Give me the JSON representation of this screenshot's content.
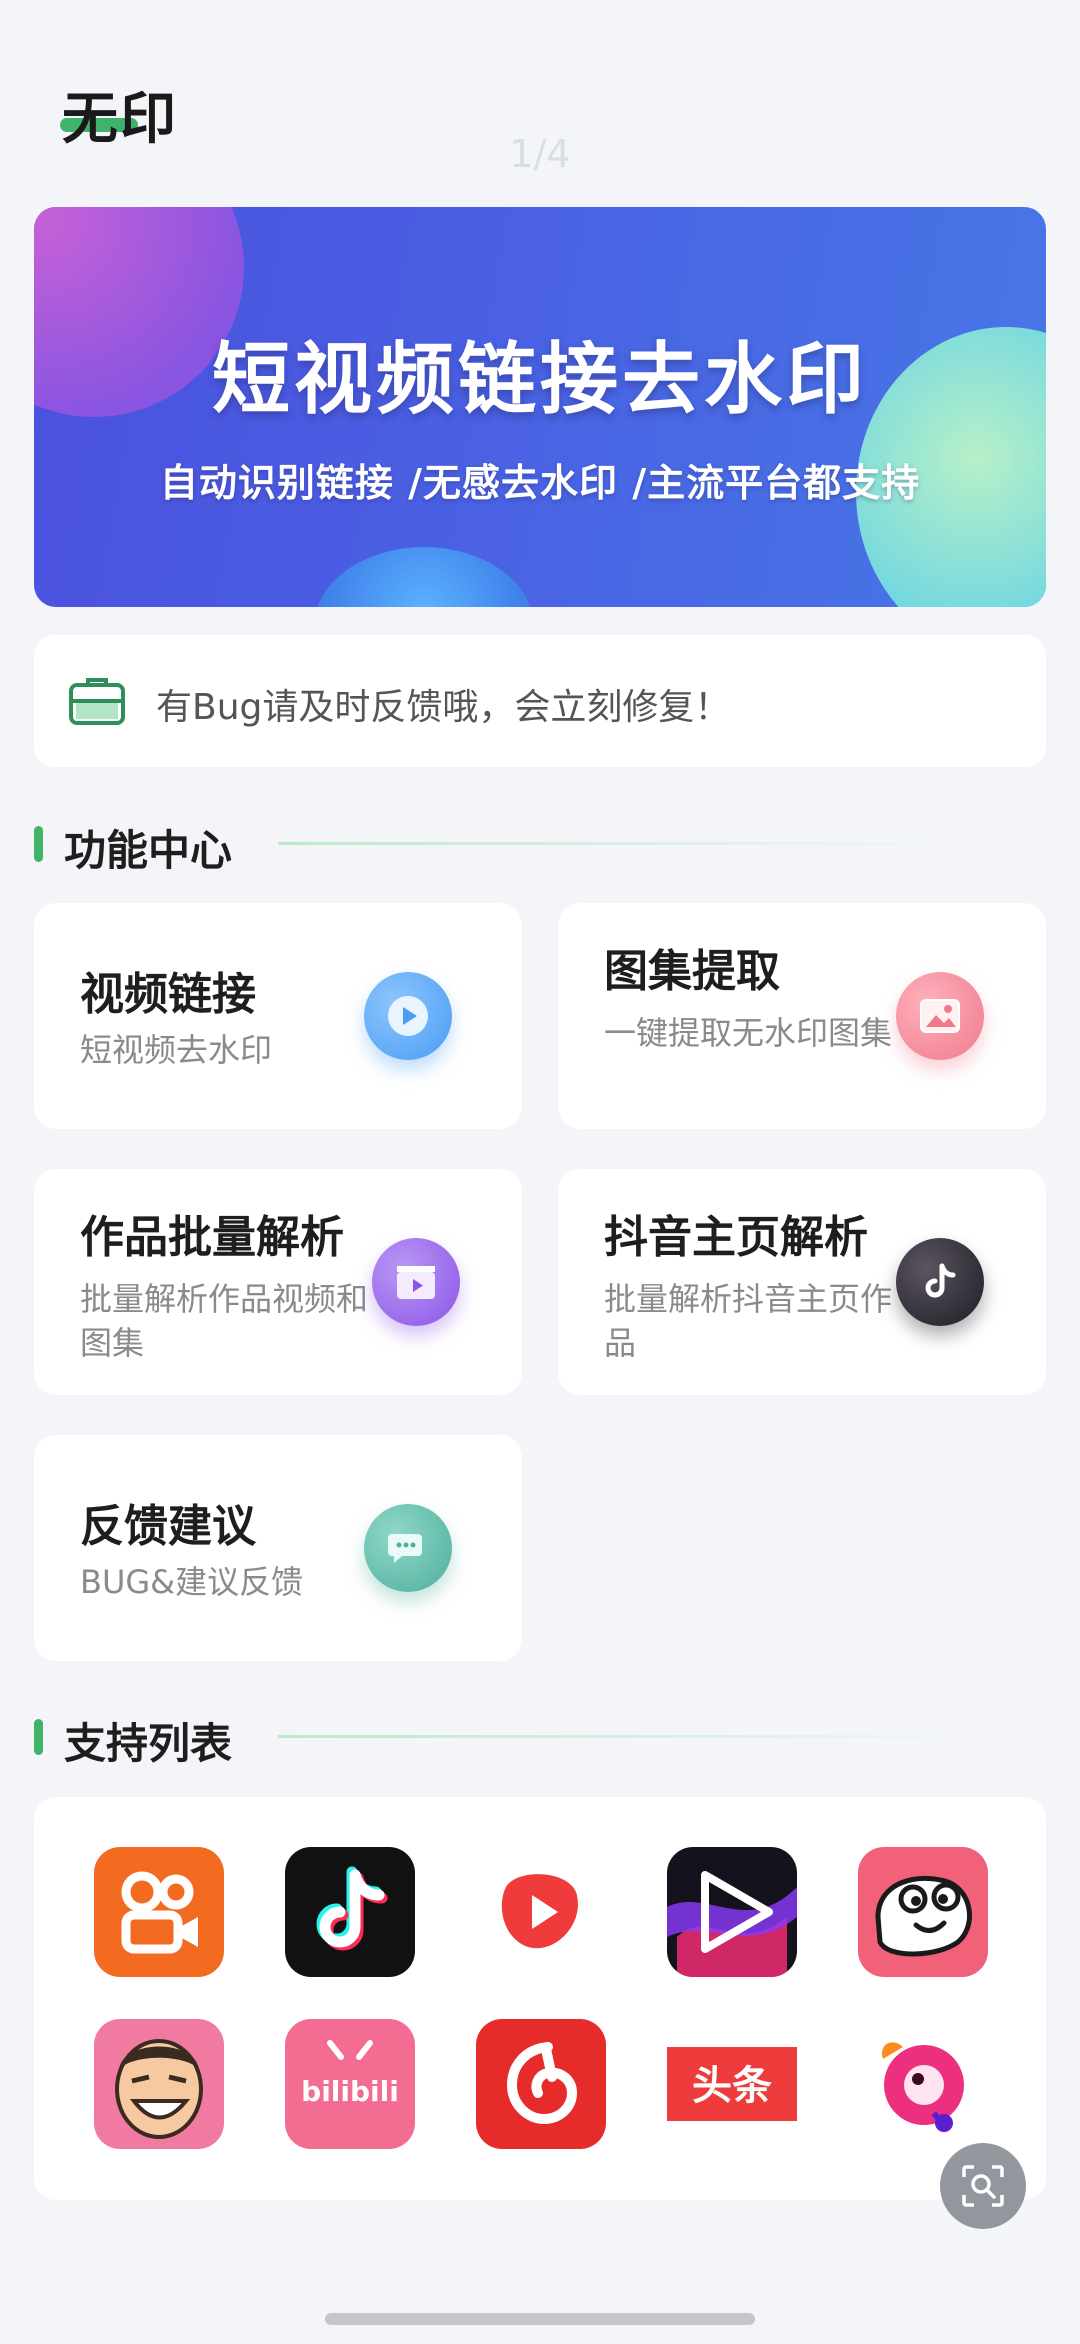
{
  "header": {
    "app_title": "无印",
    "page_indicator": "1/4"
  },
  "banner": {
    "title": "短视频链接去水印",
    "subtitle": "自动识别链接 /无感去水印 /主流平台都支持"
  },
  "notice": {
    "text": "有Bug请及时反馈哦，会立刻修复！",
    "icon": "briefcase-icon"
  },
  "sections": {
    "features_title": "功能中心",
    "platforms_title": "支持列表"
  },
  "features": [
    {
      "title": "视频链接",
      "desc": "短视频去水印",
      "icon": "play-icon",
      "color": "#4a9cf1"
    },
    {
      "title": "图集提取",
      "desc": "一键提取无水印图集",
      "icon": "image-icon",
      "color": "#ef7a8c"
    },
    {
      "title": "作品批量解析",
      "desc": "批量解析作品视频和图集",
      "icon": "clapper-icon",
      "color": "#8a55e6"
    },
    {
      "title": "抖音主页解析",
      "desc": "批量解析抖音主页作品",
      "icon": "tiktok-icon",
      "color": "#2d2a33"
    },
    {
      "title": "反馈建议",
      "desc": "BUG&建议反馈",
      "icon": "chat-bubbles-icon",
      "color": "#4fae9c"
    }
  ],
  "platforms": [
    {
      "name": "kuaishou-logo",
      "text": ""
    },
    {
      "name": "douyin-logo",
      "text": ""
    },
    {
      "name": "xigua-video-logo",
      "text": ""
    },
    {
      "name": "weishi-logo",
      "text": ""
    },
    {
      "name": "pipixia-logo",
      "text": ""
    },
    {
      "name": "zuiyou-logo",
      "text": ""
    },
    {
      "name": "bilibili-logo",
      "text": "bilibili"
    },
    {
      "name": "netease-music-logo",
      "text": ""
    },
    {
      "name": "toutiao-logo",
      "text": "头条"
    },
    {
      "name": "pipi-funny-logo",
      "text": ""
    }
  ],
  "fab": {
    "icon": "image-search-icon"
  }
}
